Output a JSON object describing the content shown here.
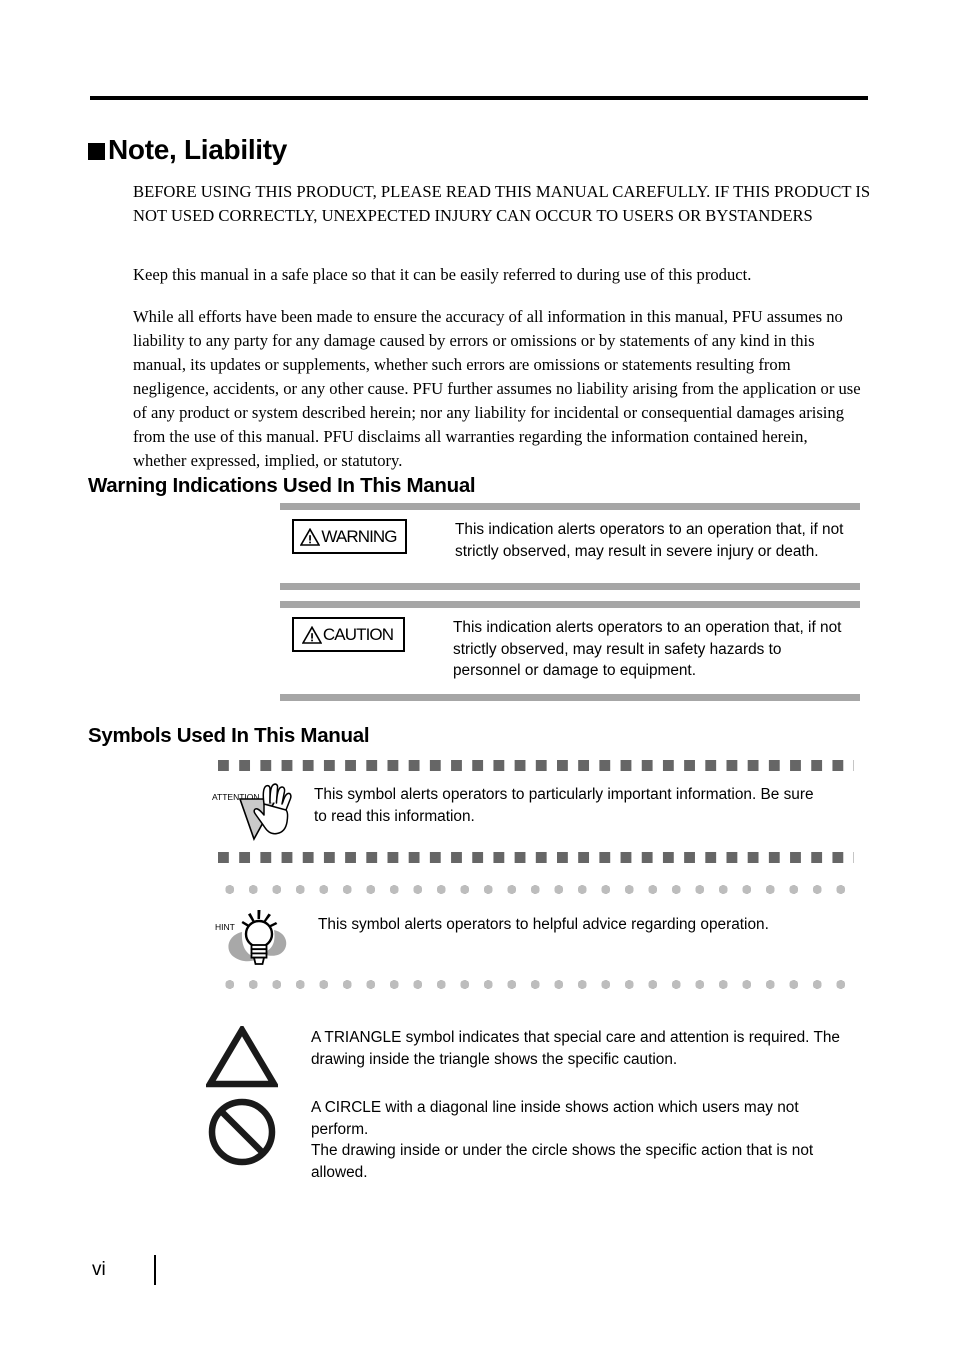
{
  "page": {
    "heading": "Note, Liability",
    "footer_page_number": "vi"
  },
  "body": {
    "intro_paragraph": "BEFORE USING THIS PRODUCT, PLEASE READ THIS MANUAL CAREFULLY. IF THIS PRODUCT IS NOT USED CORRECTLY, UNEXPECTED INJURY CAN OCCUR TO USERS OR BYSTANDERS",
    "keep_paragraph": "Keep this manual in a safe place so that it can be easily referred to during use of this product.",
    "liability_paragraph": "While all efforts have been made to ensure the accuracy of all information in this manual, PFU assumes no liability to any party for any damage caused by errors or omissions or by statements of any kind in this manual, its updates or supplements, whether such errors are omissions or statements resulting from negligence, accidents, or any other cause. PFU further assumes no liability arising from the application or use of any product or system described herein; nor any liability for incidental or consequential damages arising from the use of this manual. PFU disclaims all warranties regarding the information contained herein, whether expressed, implied, or statutory."
  },
  "sections": {
    "warning_indications_heading": "Warning Indications Used In This Manual",
    "symbols_heading": "Symbols Used In This Manual"
  },
  "alerts": [
    {
      "badge_label": "WARNING",
      "description": "This indication alerts operators to an operation that, if not strictly observed, may result in severe injury or death.",
      "icon": "warning-triangle-icon"
    },
    {
      "badge_label": "CAUTION",
      "description": "This indication alerts operators to an operation that, if not strictly observed, may result in safety hazards to personnel or damage to equipment.",
      "icon": "caution-triangle-icon"
    }
  ],
  "symbols": [
    {
      "label": "ATTENTION",
      "description": "This symbol alerts operators to particularly important information. Be sure to read this information.",
      "icon": "attention-hand-icon"
    },
    {
      "label": "HINT",
      "description": "This symbol alerts operators to helpful advice regarding operation.",
      "icon": "hint-lightbulb-icon"
    }
  ],
  "plain_symbols": [
    {
      "description": "A TRIANGLE symbol indicates that special care and attention is required. The drawing inside the triangle shows the specific caution.",
      "icon": "triangle-outline-icon"
    },
    {
      "description": "A CIRCLE with a diagonal line inside shows action which users may not perform.\nThe drawing inside or under the circle shows the specific action that is not allowed.",
      "icon": "prohibition-circle-icon"
    }
  ],
  "colors": {
    "rule": "#000000",
    "gray_bar": "#a6a6a6",
    "square_dash": "#666666",
    "dot_dash": "#bdbdbd"
  }
}
